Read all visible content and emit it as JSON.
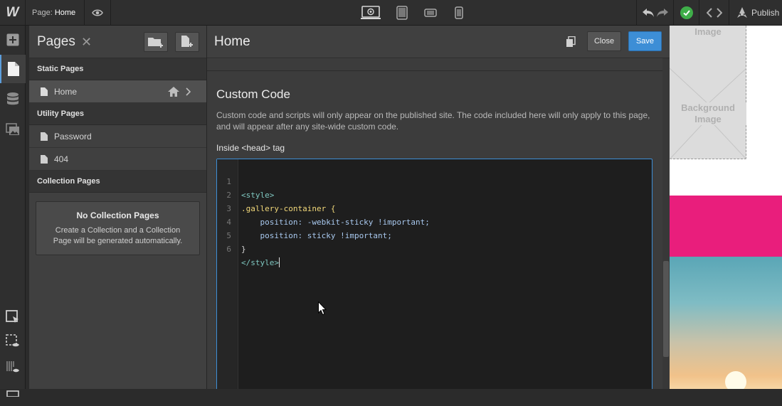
{
  "topbar": {
    "logo_text": "W",
    "page_prefix": "Page:",
    "page_name": "Home",
    "publish_label": "Publish"
  },
  "pages_panel": {
    "title": "Pages",
    "sections": {
      "static": "Static Pages",
      "utility": "Utility Pages",
      "collection": "Collection Pages"
    },
    "static_pages": [
      "Home"
    ],
    "utility_pages": [
      "Password",
      "404"
    ],
    "no_collection": {
      "title": "No Collection Pages",
      "description_line1": "Create a Collection and a Collection",
      "description_line2": "Page will be generated automatically."
    }
  },
  "settings": {
    "title": "Home",
    "close_label": "Close",
    "save_label": "Save",
    "custom_code_title": "Custom Code",
    "custom_code_desc": "Custom code and scripts will only appear on the published site. The code included here will only apply to this page, and will appear after any site-wide custom code.",
    "head_label": "Inside <head> tag",
    "code_lines": [
      {
        "n": "1",
        "text": "<style>"
      },
      {
        "n": "2",
        "text": ".gallery-container {"
      },
      {
        "n": "3",
        "text": "    position: -webkit-sticky !important;"
      },
      {
        "n": "4",
        "text": "    position: sticky !important;"
      },
      {
        "n": "5",
        "text": "}"
      },
      {
        "n": "6",
        "text": "</style>"
      }
    ]
  },
  "canvas": {
    "bg_image_label_top": "Image",
    "bg_image_label_line1": "Background",
    "bg_image_label_line2": "Image",
    "colors": {
      "pink": "#e91e7c",
      "accent": "#3d8ed6",
      "publish_ok": "#3fae49"
    }
  }
}
